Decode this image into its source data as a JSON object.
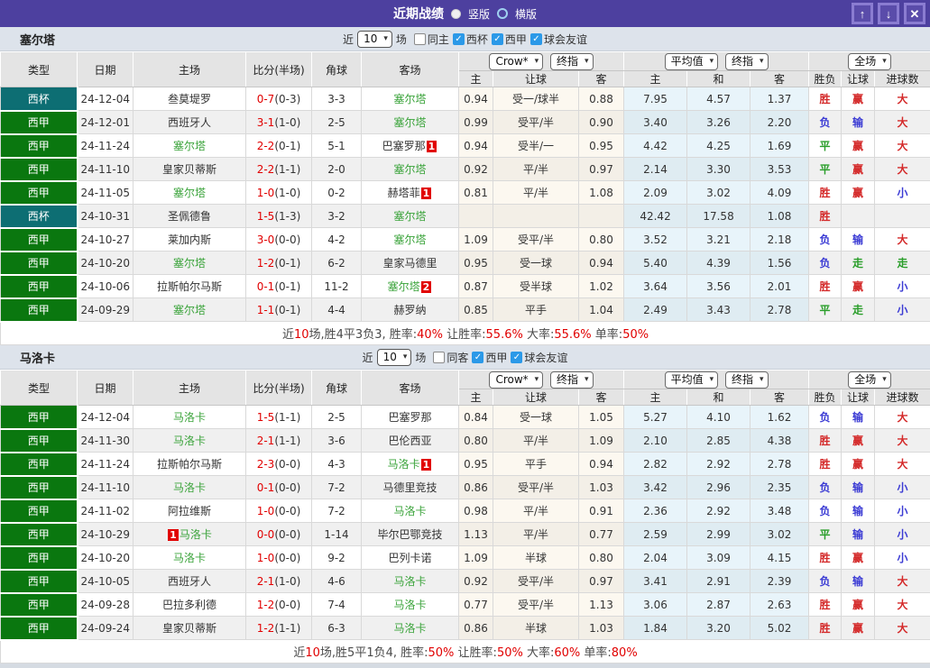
{
  "titlebar": {
    "title": "近期战绩",
    "vertical_label": "竖版",
    "horizontal_label": "横版",
    "up_glyph": "↑",
    "down_glyph": "↓",
    "close_glyph": "✕"
  },
  "colors": {
    "bar_purple": "#4d409f",
    "league_green": "#0a770f",
    "cup_teal": "#0d6e73",
    "win_red": "#d42a2a",
    "lose_blue": "#3b3bd4",
    "draw_green": "#2a9e2a",
    "accent_red": "#e10000"
  },
  "sections": [
    {
      "team": "塞尔塔",
      "filter": {
        "near_label": "近",
        "count": "10",
        "games_label": "场",
        "checkboxes": [
          {
            "label": "同主",
            "checked": false
          },
          {
            "label": "西杯",
            "checked": true
          },
          {
            "label": "西甲",
            "checked": true
          },
          {
            "label": "球会友谊",
            "checked": true
          }
        ]
      },
      "dropdowns": {
        "bookmaker": "Crow*",
        "book_type": "终指",
        "average": "平均值",
        "avg_type": "终指",
        "scope": "全场"
      },
      "headers": [
        "类型",
        "日期",
        "主场",
        "比分(半场)",
        "角球",
        "客场",
        "主",
        "让球",
        "客",
        "主",
        "和",
        "客",
        "胜负",
        "让球",
        "进球数"
      ],
      "rows": [
        {
          "type": "西杯",
          "date": "24-12-04",
          "home": {
            "name": "叁莫堤罗"
          },
          "score": "0-7",
          "half": "(0-3)",
          "corner": "3-3",
          "away": {
            "name": "塞尔塔",
            "self": true
          },
          "crown": [
            "0.94",
            "受一/球半",
            "0.88"
          ],
          "avg": [
            "7.95",
            "4.57",
            "1.37"
          ],
          "res": [
            "胜",
            "赢",
            "大"
          ]
        },
        {
          "type": "西甲",
          "date": "24-12-01",
          "home": {
            "name": "西班牙人"
          },
          "score": "3-1",
          "half": "(1-0)",
          "corner": "2-5",
          "away": {
            "name": "塞尔塔",
            "self": true
          },
          "crown": [
            "0.99",
            "受平/半",
            "0.90"
          ],
          "avg": [
            "3.40",
            "3.26",
            "2.20"
          ],
          "res": [
            "负",
            "输",
            "大"
          ]
        },
        {
          "type": "西甲",
          "date": "24-11-24",
          "home": {
            "name": "塞尔塔",
            "self": true
          },
          "score": "2-2",
          "half": "(0-1)",
          "corner": "5-1",
          "away": {
            "name": "巴塞罗那",
            "badge": "1"
          },
          "crown": [
            "0.94",
            "受半/一",
            "0.95"
          ],
          "avg": [
            "4.42",
            "4.25",
            "1.69"
          ],
          "res": [
            "平",
            "赢",
            "大"
          ]
        },
        {
          "type": "西甲",
          "date": "24-11-10",
          "home": {
            "name": "皇家贝蒂斯"
          },
          "score": "2-2",
          "half": "(1-1)",
          "corner": "2-0",
          "away": {
            "name": "塞尔塔",
            "self": true
          },
          "crown": [
            "0.92",
            "平/半",
            "0.97"
          ],
          "avg": [
            "2.14",
            "3.30",
            "3.53"
          ],
          "res": [
            "平",
            "赢",
            "大"
          ]
        },
        {
          "type": "西甲",
          "date": "24-11-05",
          "home": {
            "name": "塞尔塔",
            "self": true
          },
          "score": "1-0",
          "half": "(1-0)",
          "corner": "0-2",
          "away": {
            "name": "赫塔菲",
            "badge": "1"
          },
          "crown": [
            "0.81",
            "平/半",
            "1.08"
          ],
          "avg": [
            "2.09",
            "3.02",
            "4.09"
          ],
          "res": [
            "胜",
            "赢",
            "小"
          ]
        },
        {
          "type": "西杯",
          "date": "24-10-31",
          "home": {
            "name": "圣佩德鲁"
          },
          "score": "1-5",
          "half": "(1-3)",
          "corner": "3-2",
          "away": {
            "name": "塞尔塔",
            "self": true
          },
          "crown": [
            "",
            "",
            ""
          ],
          "avg": [
            "42.42",
            "17.58",
            "1.08"
          ],
          "res": [
            "胜",
            "",
            ""
          ]
        },
        {
          "type": "西甲",
          "date": "24-10-27",
          "home": {
            "name": "莱加内斯"
          },
          "score": "3-0",
          "half": "(0-0)",
          "corner": "4-2",
          "away": {
            "name": "塞尔塔",
            "self": true
          },
          "crown": [
            "1.09",
            "受平/半",
            "0.80"
          ],
          "avg": [
            "3.52",
            "3.21",
            "2.18"
          ],
          "res": [
            "负",
            "输",
            "大"
          ]
        },
        {
          "type": "西甲",
          "date": "24-10-20",
          "home": {
            "name": "塞尔塔",
            "self": true
          },
          "score": "1-2",
          "half": "(0-1)",
          "corner": "6-2",
          "away": {
            "name": "皇家马德里"
          },
          "crown": [
            "0.95",
            "受一球",
            "0.94"
          ],
          "avg": [
            "5.40",
            "4.39",
            "1.56"
          ],
          "res": [
            "负",
            "走",
            "走"
          ]
        },
        {
          "type": "西甲",
          "date": "24-10-06",
          "home": {
            "name": "拉斯帕尔马斯"
          },
          "score": "0-1",
          "half": "(0-1)",
          "corner": "11-2",
          "away": {
            "name": "塞尔塔",
            "self": true,
            "badge": "2"
          },
          "crown": [
            "0.87",
            "受半球",
            "1.02"
          ],
          "avg": [
            "3.64",
            "3.56",
            "2.01"
          ],
          "res": [
            "胜",
            "赢",
            "小"
          ]
        },
        {
          "type": "西甲",
          "date": "24-09-29",
          "home": {
            "name": "塞尔塔",
            "self": true
          },
          "score": "1-1",
          "half": "(0-1)",
          "corner": "4-4",
          "away": {
            "name": "赫罗纳"
          },
          "crown": [
            "0.85",
            "平手",
            "1.04"
          ],
          "avg": [
            "2.49",
            "3.43",
            "2.78"
          ],
          "res": [
            "平",
            "走",
            "小"
          ]
        }
      ],
      "summary": [
        [
          "近",
          0
        ],
        [
          "10",
          1
        ],
        [
          "场,胜4平3负3, 胜率:",
          0
        ],
        [
          "40%",
          1
        ],
        [
          " 让胜率:",
          0
        ],
        [
          "55.6%",
          1
        ],
        [
          " 大率:",
          0
        ],
        [
          "55.6%",
          1
        ],
        [
          " 单率:",
          0
        ],
        [
          "50%",
          1
        ]
      ]
    },
    {
      "team": "马洛卡",
      "filter": {
        "near_label": "近",
        "count": "10",
        "games_label": "场",
        "checkboxes": [
          {
            "label": "同客",
            "checked": false
          },
          {
            "label": "西甲",
            "checked": true
          },
          {
            "label": "球会友谊",
            "checked": true
          }
        ]
      },
      "dropdowns": {
        "bookmaker": "Crow*",
        "book_type": "终指",
        "average": "平均值",
        "avg_type": "终指",
        "scope": "全场"
      },
      "headers": [
        "类型",
        "日期",
        "主场",
        "比分(半场)",
        "角球",
        "客场",
        "主",
        "让球",
        "客",
        "主",
        "和",
        "客",
        "胜负",
        "让球",
        "进球数"
      ],
      "rows": [
        {
          "type": "西甲",
          "date": "24-12-04",
          "home": {
            "name": "马洛卡",
            "self": true
          },
          "score": "1-5",
          "half": "(1-1)",
          "corner": "2-5",
          "away": {
            "name": "巴塞罗那"
          },
          "crown": [
            "0.84",
            "受一球",
            "1.05"
          ],
          "avg": [
            "5.27",
            "4.10",
            "1.62"
          ],
          "res": [
            "负",
            "输",
            "大"
          ]
        },
        {
          "type": "西甲",
          "date": "24-11-30",
          "home": {
            "name": "马洛卡",
            "self": true
          },
          "score": "2-1",
          "half": "(1-1)",
          "corner": "3-6",
          "away": {
            "name": "巴伦西亚"
          },
          "crown": [
            "0.80",
            "平/半",
            "1.09"
          ],
          "avg": [
            "2.10",
            "2.85",
            "4.38"
          ],
          "res": [
            "胜",
            "赢",
            "大"
          ]
        },
        {
          "type": "西甲",
          "date": "24-11-24",
          "home": {
            "name": "拉斯帕尔马斯"
          },
          "score": "2-3",
          "half": "(0-0)",
          "corner": "4-3",
          "away": {
            "name": "马洛卡",
            "self": true,
            "badge": "1"
          },
          "crown": [
            "0.95",
            "平手",
            "0.94"
          ],
          "avg": [
            "2.82",
            "2.92",
            "2.78"
          ],
          "res": [
            "胜",
            "赢",
            "大"
          ]
        },
        {
          "type": "西甲",
          "date": "24-11-10",
          "home": {
            "name": "马洛卡",
            "self": true
          },
          "score": "0-1",
          "half": "(0-0)",
          "corner": "7-2",
          "away": {
            "name": "马德里竞技"
          },
          "crown": [
            "0.86",
            "受平/半",
            "1.03"
          ],
          "avg": [
            "3.42",
            "2.96",
            "2.35"
          ],
          "res": [
            "负",
            "输",
            "小"
          ]
        },
        {
          "type": "西甲",
          "date": "24-11-02",
          "home": {
            "name": "阿拉维斯"
          },
          "score": "1-0",
          "half": "(0-0)",
          "corner": "7-2",
          "away": {
            "name": "马洛卡",
            "self": true
          },
          "crown": [
            "0.98",
            "平/半",
            "0.91"
          ],
          "avg": [
            "2.36",
            "2.92",
            "3.48"
          ],
          "res": [
            "负",
            "输",
            "小"
          ]
        },
        {
          "type": "西甲",
          "date": "24-10-29",
          "home": {
            "name": "马洛卡",
            "self": true,
            "badge": "1",
            "badge_pos": "before"
          },
          "score": "0-0",
          "half": "(0-0)",
          "corner": "1-14",
          "away": {
            "name": "毕尔巴鄂竞技"
          },
          "crown": [
            "1.13",
            "平/半",
            "0.77"
          ],
          "avg": [
            "2.59",
            "2.99",
            "3.02"
          ],
          "res": [
            "平",
            "输",
            "小"
          ]
        },
        {
          "type": "西甲",
          "date": "24-10-20",
          "home": {
            "name": "马洛卡",
            "self": true
          },
          "score": "1-0",
          "half": "(0-0)",
          "corner": "9-2",
          "away": {
            "name": "巴列卡诺"
          },
          "crown": [
            "1.09",
            "半球",
            "0.80"
          ],
          "avg": [
            "2.04",
            "3.09",
            "4.15"
          ],
          "res": [
            "胜",
            "赢",
            "小"
          ]
        },
        {
          "type": "西甲",
          "date": "24-10-05",
          "home": {
            "name": "西班牙人"
          },
          "score": "2-1",
          "half": "(1-0)",
          "corner": "4-6",
          "away": {
            "name": "马洛卡",
            "self": true
          },
          "crown": [
            "0.92",
            "受平/半",
            "0.97"
          ],
          "avg": [
            "3.41",
            "2.91",
            "2.39"
          ],
          "res": [
            "负",
            "输",
            "大"
          ]
        },
        {
          "type": "西甲",
          "date": "24-09-28",
          "home": {
            "name": "巴拉多利德"
          },
          "score": "1-2",
          "half": "(0-0)",
          "corner": "7-4",
          "away": {
            "name": "马洛卡",
            "self": true
          },
          "crown": [
            "0.77",
            "受平/半",
            "1.13"
          ],
          "avg": [
            "3.06",
            "2.87",
            "2.63"
          ],
          "res": [
            "胜",
            "赢",
            "大"
          ]
        },
        {
          "type": "西甲",
          "date": "24-09-24",
          "home": {
            "name": "皇家贝蒂斯"
          },
          "score": "1-2",
          "half": "(1-1)",
          "corner": "6-3",
          "away": {
            "name": "马洛卡",
            "self": true
          },
          "crown": [
            "0.86",
            "半球",
            "1.03"
          ],
          "avg": [
            "1.84",
            "3.20",
            "5.02"
          ],
          "res": [
            "胜",
            "赢",
            "大"
          ]
        }
      ],
      "summary": [
        [
          "近",
          0
        ],
        [
          "10",
          1
        ],
        [
          "场,胜5平1负4, 胜率:",
          0
        ],
        [
          "50%",
          1
        ],
        [
          " 让胜率:",
          0
        ],
        [
          "50%",
          1
        ],
        [
          " 大率:",
          0
        ],
        [
          "60%",
          1
        ],
        [
          " 单率:",
          0
        ],
        [
          "80%",
          1
        ]
      ]
    }
  ]
}
